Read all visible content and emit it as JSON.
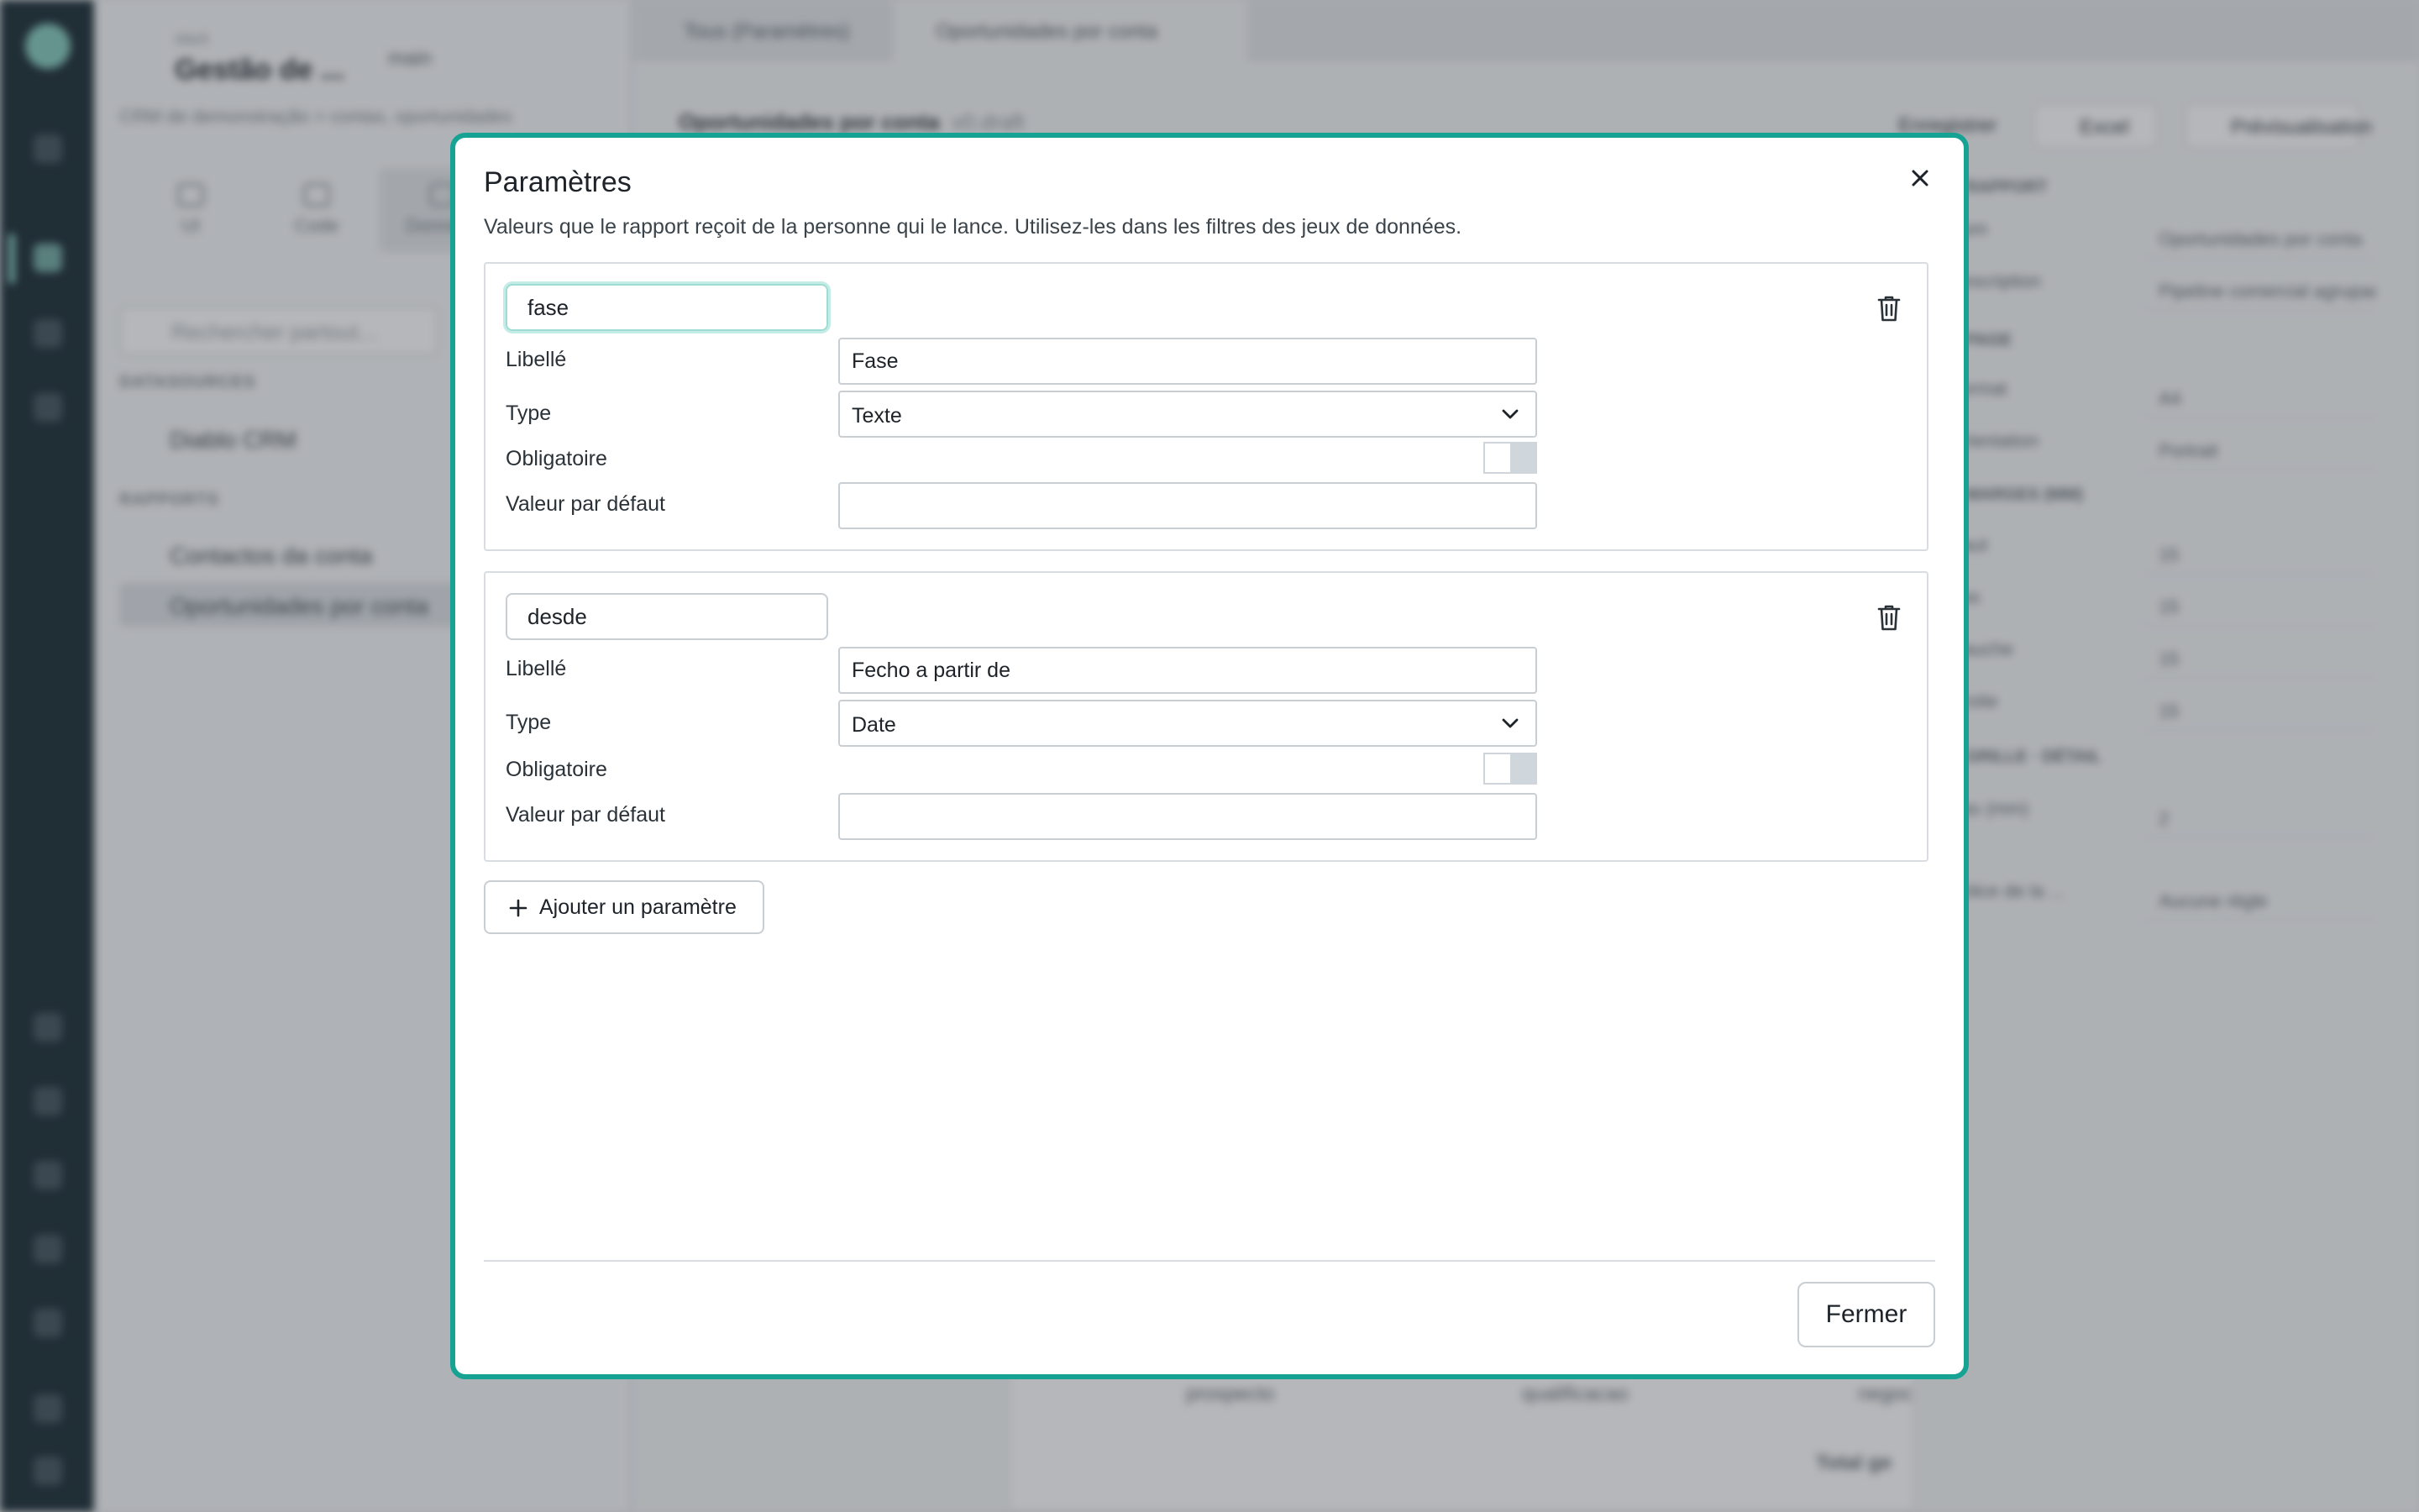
{
  "background": {
    "workspace_small": "slack",
    "workspace_title": "Gestão de ...",
    "branch": "main",
    "subtitle": "CRM de demonstração > contas, oportunidades",
    "side_tabs": [
      {
        "label": "UI"
      },
      {
        "label": "Code"
      },
      {
        "label": "Données"
      }
    ],
    "search_placeholder": "Rechercher partout...",
    "section_datasources": "DATASOURCES",
    "datasource_item": "Diablo CRM",
    "section_reports": "RAPPORTS",
    "report_items": [
      "Contactos da conta",
      "Oportunidades por conta"
    ],
    "tabs": [
      "Tous (Paramètres)",
      "Oportunidades por conta"
    ],
    "report_title": "Oportunidades por conta",
    "report_title_badge": "v0.draft",
    "toolbar": {
      "save_label": "Enregistrer",
      "excel_label": "Excel",
      "preview_label": "Prévisualisation"
    },
    "right_panel": {
      "heading1": "RAPPORT",
      "rows1": [
        {
          "label": "Nom",
          "value": "Oportunidades por conta"
        },
        {
          "label": "Description",
          "value": "Pipeline comercial agrupado"
        }
      ],
      "heading2": "PAGE",
      "rows2": [
        {
          "label": "Format",
          "value": "A4"
        },
        {
          "label": "Orientation",
          "value": "Portrait"
        }
      ],
      "heading3": "MARGES (MM)",
      "rows3": [
        {
          "label": "Haut",
          "value": "15"
        },
        {
          "label": "Bas",
          "value": "15"
        },
        {
          "label": "Gauche",
          "value": "15"
        },
        {
          "label": "Droite",
          "value": "15"
        }
      ],
      "heading4": "GRILLE · DÉTAIL",
      "rows4": [
        {
          "label": "Pas (mm)",
          "value": "2"
        },
        {
          "label": "Police de la ...",
          "value": "Aucune règle"
        }
      ]
    },
    "table_cells": [
      "prospecto",
      "qualificacao",
      "negoc",
      "Total ge"
    ]
  },
  "modal": {
    "title": "Paramètres",
    "description": "Valeurs que le rapport reçoit de la personne qui le lance. Utilisez-les dans les filtres des jeux de données.",
    "params": [
      {
        "key": "fase",
        "label_caption": "Libellé",
        "label_value": "Fase",
        "type_caption": "Type",
        "type_value": "Texte",
        "required_caption": "Obligatoire",
        "required": false,
        "default_caption": "Valeur par défaut",
        "default_value": ""
      },
      {
        "key": "desde",
        "label_caption": "Libellé",
        "label_value": "Fecho a partir de",
        "type_caption": "Type",
        "type_value": "Date",
        "required_caption": "Obligatoire",
        "required": false,
        "default_caption": "Valeur par défaut",
        "default_value": ""
      }
    ],
    "add_param_label": "Ajouter un paramètre",
    "close_label": "Fermer"
  },
  "colors": {
    "accent": "#16a394",
    "rail": "#10222b"
  }
}
